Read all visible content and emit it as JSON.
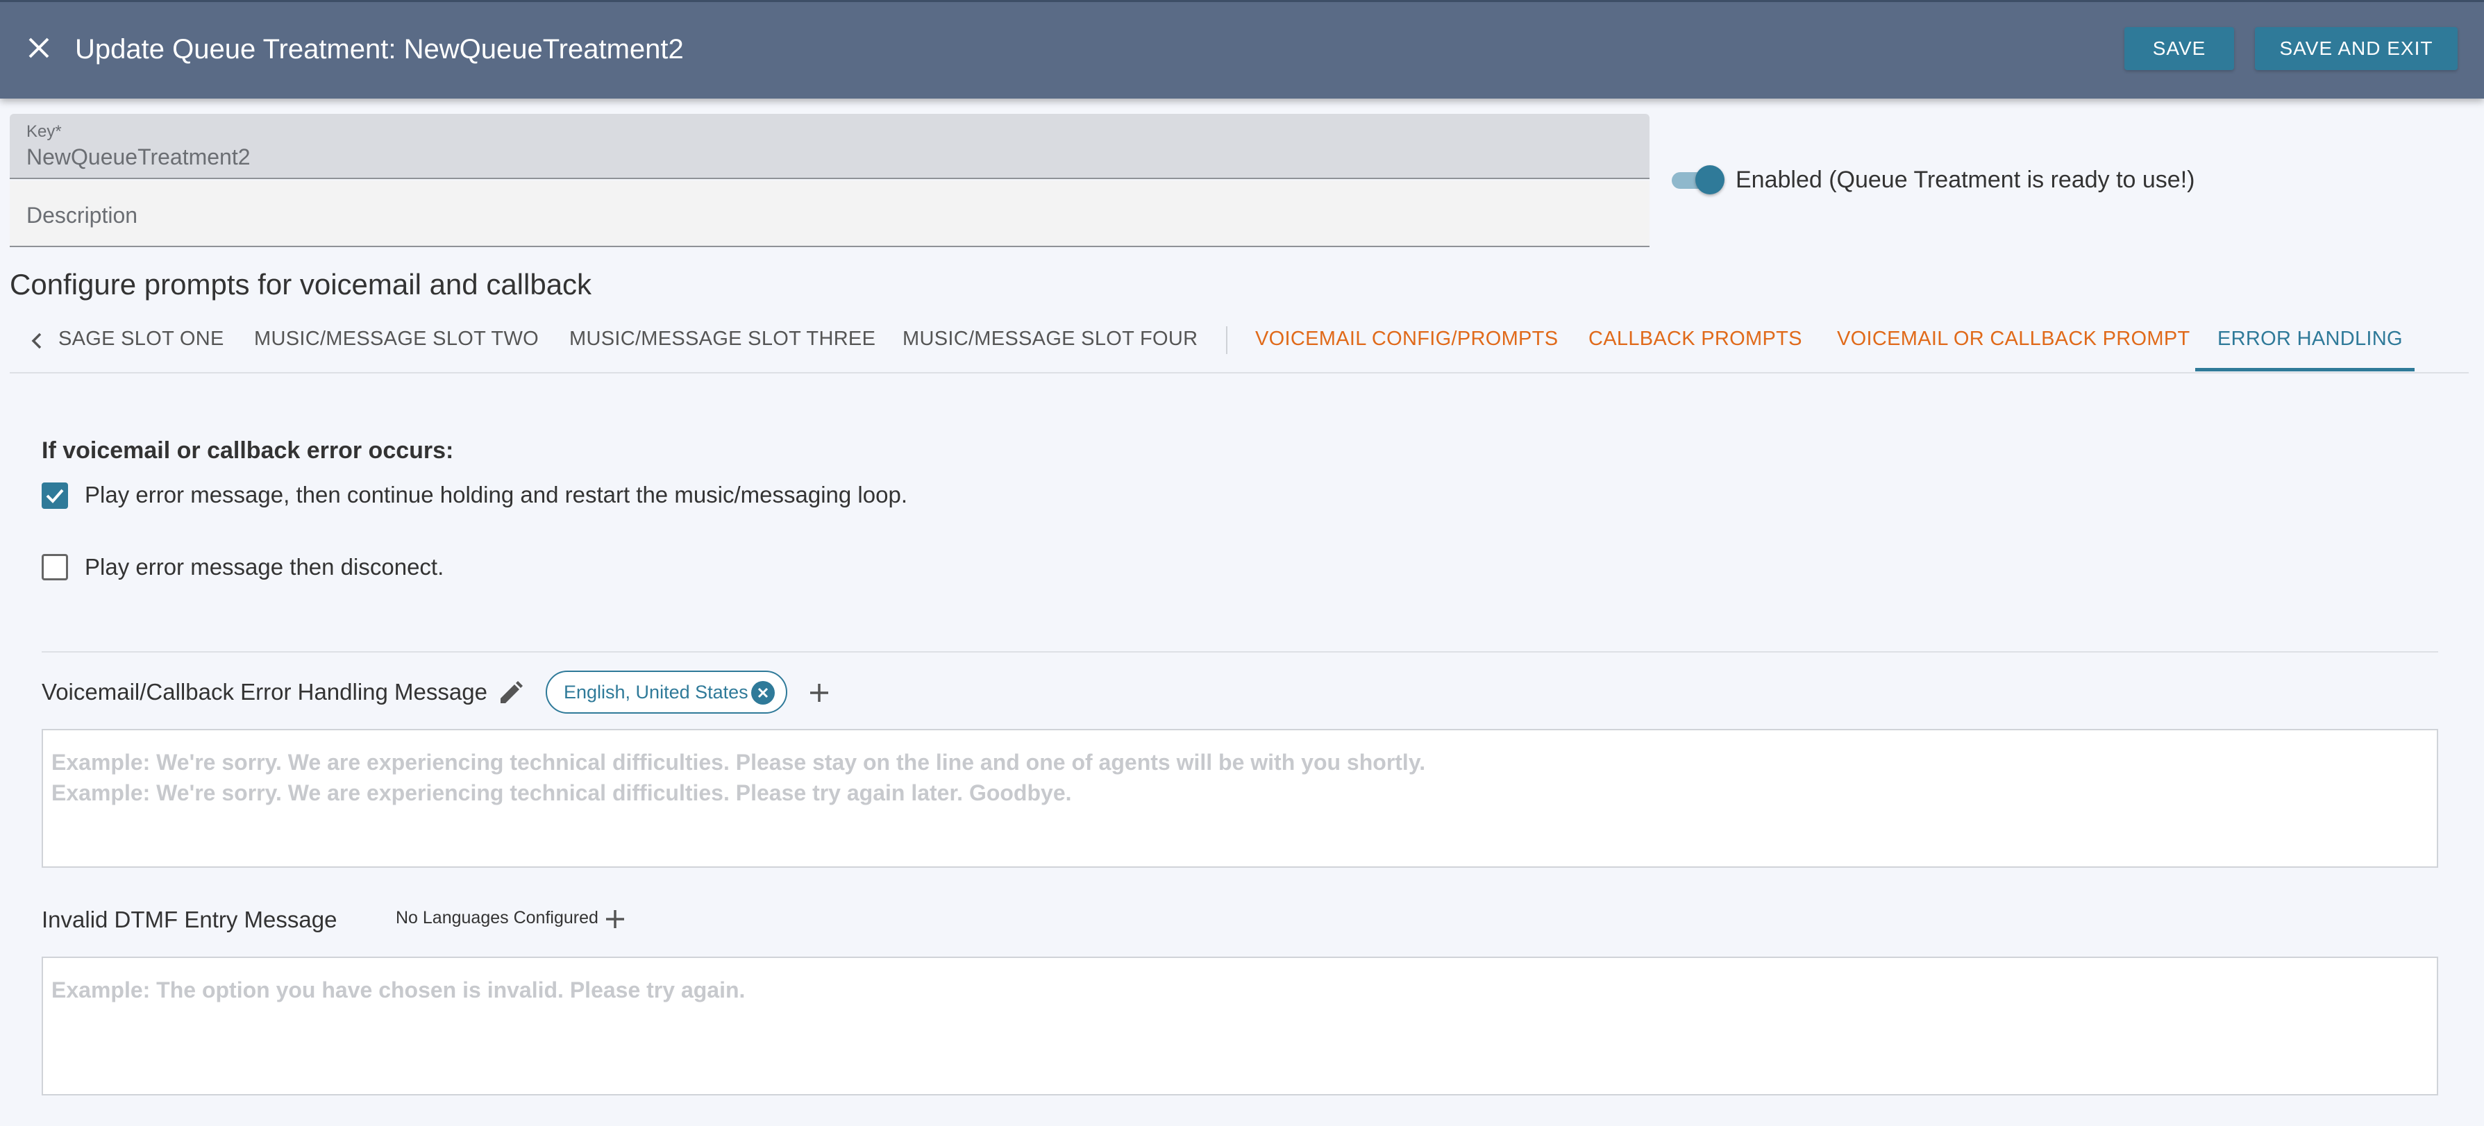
{
  "header": {
    "title": "Update Queue Treatment: NewQueueTreatment2",
    "save_label": "SAVE",
    "save_exit_label": "SAVE AND EXIT"
  },
  "form": {
    "key_label": "Key*",
    "key_value": "NewQueueTreatment2",
    "description_placeholder": "Description",
    "enabled_label": "Enabled (Queue Treatment is ready to use!)",
    "enabled": true
  },
  "section_title": "Configure prompts for voicemail and callback",
  "tabs": [
    {
      "label": "SAGE SLOT ONE",
      "style": "grey"
    },
    {
      "label": "MUSIC/MESSAGE SLOT TWO",
      "style": "grey"
    },
    {
      "label": "MUSIC/MESSAGE SLOT THREE",
      "style": "grey"
    },
    {
      "label": "MUSIC/MESSAGE SLOT FOUR",
      "style": "grey"
    },
    {
      "label": "VOICEMAIL CONFIG/PROMPTS",
      "style": "orange"
    },
    {
      "label": "CALLBACK PROMPTS",
      "style": "orange"
    },
    {
      "label": "VOICEMAIL OR CALLBACK PROMPT",
      "style": "orange"
    },
    {
      "label": "ERROR HANDLING",
      "style": "active"
    }
  ],
  "error_handling": {
    "heading": "If voicemail or callback error occurs:",
    "option_continue": "Play error message, then continue holding and restart the music/messaging loop.",
    "option_continue_checked": true,
    "option_disconnect": "Play error message then disconect.",
    "option_disconnect_checked": false
  },
  "error_message": {
    "label": "Voicemail/Callback Error Handling Message",
    "language_chip": "English, United States",
    "placeholder": "Example: We're sorry. We are experiencing technical difficulties. Please stay on the line and one of agents will be with you shortly.\nExample: We're sorry. We are experiencing technical difficulties. Please try again later. Goodbye."
  },
  "dtmf_message": {
    "label": "Invalid DTMF Entry Message",
    "no_languages": "No Languages Configured",
    "placeholder": "Example: The option you have chosen is invalid. Please try again."
  },
  "colors": {
    "header_bg": "#5a6b86",
    "accent": "#2f7a99",
    "tab_orange": "#e06a1a"
  },
  "icons": [
    "close-icon",
    "chevron-left-icon",
    "pencil-icon",
    "chip-close-icon",
    "plus-icon",
    "check-icon"
  ]
}
